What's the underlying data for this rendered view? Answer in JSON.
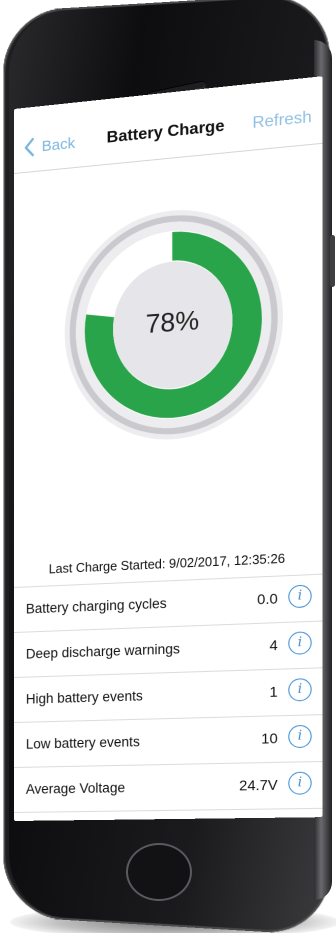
{
  "nav": {
    "back_label": "Back",
    "title": "Battery Charge",
    "refresh_label": "Refresh"
  },
  "gauge": {
    "value_label": "78%",
    "fraction": 0.78
  },
  "last_charge": "Last Charge Started: 9/02/2017, 12:35:26",
  "stats": [
    {
      "label": "Battery charging cycles",
      "value": "0.0"
    },
    {
      "label": "Deep discharge warnings",
      "value": "4"
    },
    {
      "label": "High battery events",
      "value": "1"
    },
    {
      "label": "Low battery events",
      "value": "10"
    },
    {
      "label": "Average Voltage",
      "value": "24.7V"
    }
  ],
  "info_glyph": "i",
  "colors": {
    "accent": "#7ab5e0",
    "info": "#3d8fd6",
    "gauge_fill": "#2aa44a",
    "gauge_track": "#e4e4e8",
    "gauge_ring": "#c9c9ce"
  }
}
